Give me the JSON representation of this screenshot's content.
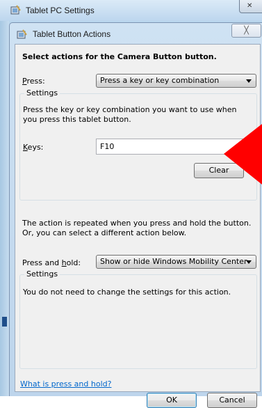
{
  "outer_window": {
    "title": "Tablet PC Settings",
    "app_icon": "tablet-pc-icon",
    "close_icon": "close-icon"
  },
  "dialog": {
    "title": "Tablet Button Actions",
    "app_icon": "tablet-pc-icon",
    "close_icon": "close-icon",
    "close_glyph": "╳"
  },
  "heading": "Select actions for the Camera Button button.",
  "press": {
    "label_rest": "ress:",
    "label_hotkey": "P",
    "selected": "Press a key or key combination",
    "settings_title": "Settings",
    "description": "Press the key or key combination you want to use when you press this tablet button.",
    "keys_label_hotkey": "K",
    "keys_label_rest": "eys:",
    "keys_value": "F10",
    "clear_label": "Clear"
  },
  "repeat_note": "The action is repeated when you press and hold the button. Or, you can select a different action below.",
  "press_and_hold": {
    "label_prefix": "Press and ",
    "label_hotkey": "h",
    "label_suffix": "old:",
    "selected": "Show or hide Windows Mobility Center",
    "settings_title": "Settings",
    "description": "You do not need to change the settings for this action."
  },
  "help_link": "What is press and hold?",
  "ok_label": "OK",
  "cancel_label": "Cancel",
  "colors": {
    "annotation_arrow": "#ff0000",
    "link": "#0066cc"
  }
}
